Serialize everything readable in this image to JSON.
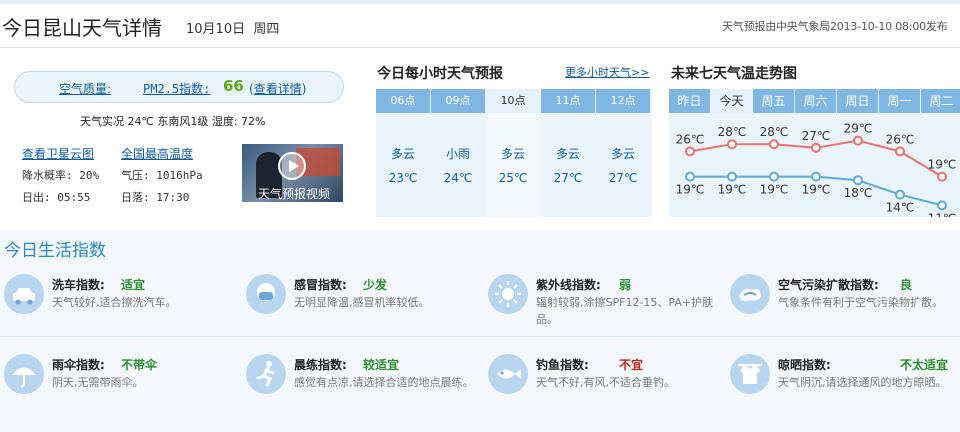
{
  "header": {
    "title": "今日昆山天气详情",
    "date": "10月10日",
    "weekday": "周四",
    "source": "天气预报由中央气象局2013-10-10 08:00发布"
  },
  "air": {
    "label": "空气质量:",
    "pm_label": "PM2.5指数:",
    "pm_value": "66",
    "detail_open": "(",
    "detail_link": "查看详情",
    "detail_close": ")"
  },
  "live": "天气实况 24℃ 东南风1级 湿度: 72%",
  "links": {
    "satellite": "查看卫星云图",
    "max_temp": "全国最高温度"
  },
  "stats": {
    "rain_prob": "降水概率: 20%",
    "pressure": "气压: 1016hPa",
    "sunrise": "日出: 05:55",
    "sunset": "日落: 17:30"
  },
  "video": {
    "label": "天气预报视频"
  },
  "hourly": {
    "title": "今日每小时天气预报",
    "more": "更多小时天气>>",
    "items": [
      {
        "time": "06点",
        "cond": "多云",
        "temp": "23℃"
      },
      {
        "time": "09点",
        "cond": "小雨",
        "temp": "24℃"
      },
      {
        "time": "10点",
        "cond": "多云",
        "temp": "25℃"
      },
      {
        "time": "11点",
        "cond": "多云",
        "temp": "27℃"
      },
      {
        "time": "12点",
        "cond": "多云",
        "temp": "27℃"
      }
    ]
  },
  "week": {
    "title": "未来七天气温走势图",
    "days": [
      "昨日",
      "今天",
      "周五",
      "周六",
      "周日",
      "周一",
      "周二"
    ]
  },
  "chart_data": {
    "type": "line",
    "categories": [
      "昨日",
      "今天",
      "周五",
      "周六",
      "周日",
      "周一",
      "周二"
    ],
    "series": [
      {
        "values": [
          26,
          28,
          28,
          27,
          29,
          26,
          19
        ],
        "labels": [
          "26℃",
          "28℃",
          "28℃",
          "27℃",
          "29℃",
          "26℃",
          "19℃"
        ],
        "color": "#e8736a"
      },
      {
        "values": [
          19,
          19,
          19,
          19,
          18,
          14,
          11
        ],
        "labels": [
          "19℃",
          "19℃",
          "19℃",
          "19℃",
          "18℃",
          "14℃",
          "11℃"
        ],
        "color": "#5fa8dc"
      }
    ]
  },
  "life": {
    "title": "今日生活指数",
    "items": [
      {
        "name": "洗车指数:",
        "value": "适宜",
        "color": "#2e8b2e",
        "desc": "天气较好,适合擦洗汽车。",
        "icon": "car-wash-icon"
      },
      {
        "name": "感冒指数:",
        "value": "少发",
        "color": "#2e8b2e",
        "desc": "无明显降温,感冒机率较低。",
        "icon": "mask-icon"
      },
      {
        "name": "紫外线指数:",
        "value": "弱",
        "color": "#2e8b2e",
        "desc": "辐射较弱,涂擦SPF12-15、PA+护肤品。",
        "icon": "sun-icon"
      },
      {
        "name": "空气污染扩散指数:",
        "value": "良",
        "color": "#2e8b2e",
        "desc": "气象条件有利于空气污染物扩散。",
        "icon": "wind-icon"
      },
      {
        "name": "雨伞指数:",
        "value": "不带伞",
        "color": "#2e8b2e",
        "desc": "阴天,无需带雨伞。",
        "icon": "umbrella-icon"
      },
      {
        "name": "晨练指数:",
        "value": "较适宜",
        "color": "#2e8b2e",
        "desc": "感觉有点凉,请选择合适的地点晨练。",
        "icon": "runner-icon"
      },
      {
        "name": "钓鱼指数:",
        "value": "不宜",
        "color": "#c0281c",
        "desc": "天气不好,有风,不适合垂钓。",
        "icon": "fish-icon"
      },
      {
        "name": "晾晒指数:",
        "value": "不太适宜",
        "color": "#2e8b2e",
        "desc": "天气阴沉,请选择通风的地方晾晒。",
        "icon": "clothes-drying-icon"
      }
    ]
  }
}
